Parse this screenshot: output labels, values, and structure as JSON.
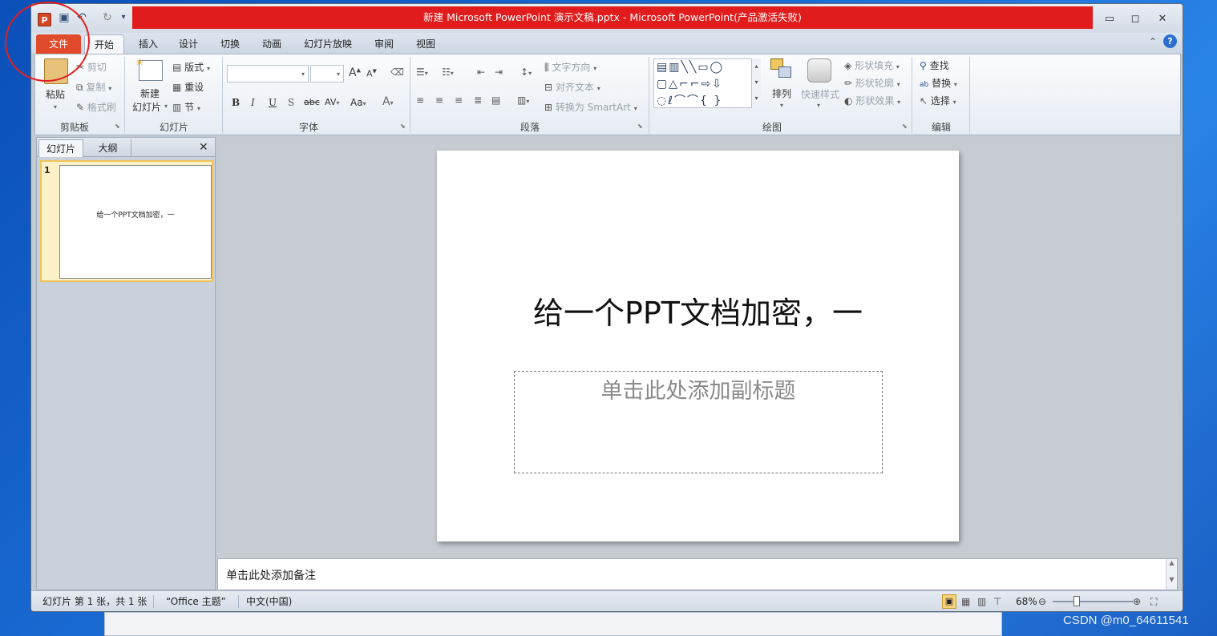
{
  "window": {
    "title": "新建 Microsoft PowerPoint 演示文稿.pptx - Microsoft PowerPoint(产品激活失败)"
  },
  "tabs": [
    {
      "label": "文件"
    },
    {
      "label": "开始"
    },
    {
      "label": "插入"
    },
    {
      "label": "设计"
    },
    {
      "label": "切换"
    },
    {
      "label": "动画"
    },
    {
      "label": "幻灯片放映"
    },
    {
      "label": "审阅"
    },
    {
      "label": "视图"
    }
  ],
  "ribbon": {
    "clipboard": {
      "paste": "粘贴",
      "cut": "剪切",
      "copy": "复制",
      "format_painter": "格式刷",
      "group": "剪贴板"
    },
    "slides": {
      "new_slide_1": "新建",
      "new_slide_2": "幻灯片",
      "layout": "版式",
      "reset": "重设",
      "section": "节",
      "group": "幻灯片"
    },
    "font": {
      "group": "字体",
      "bold": "B",
      "italic": "I",
      "underline": "U",
      "shadow": "S",
      "strike": "abc",
      "spacing": "AV",
      "case": "Aa",
      "color": "A",
      "grow": "A",
      "shrink": "A"
    },
    "paragraph": {
      "text_direction": "文字方向",
      "align_text": "对齐文本",
      "smartart": "转换为 SmartArt",
      "group": "段落"
    },
    "drawing": {
      "arrange": "排列",
      "quick_styles": "快速样式",
      "shape_fill": "形状填充",
      "shape_outline": "形状轮廓",
      "shape_effects": "形状效果",
      "group": "绘图"
    },
    "editing": {
      "find": "查找",
      "replace": "替换",
      "select": "选择",
      "group": "编辑"
    }
  },
  "left_panel": {
    "tab_slides": "幻灯片",
    "tab_outline": "大纲",
    "slide_number": "1",
    "thumb_text": "给一个PPT文档加密，一"
  },
  "slide": {
    "title": "给一个PPT文档加密，一",
    "subtitle_placeholder": "单击此处添加副标题"
  },
  "notes": {
    "placeholder": "单击此处添加备注"
  },
  "status": {
    "slide_info": "幻灯片 第 1 张，共 1 张",
    "theme": "“Office 主题”",
    "language": "中文(中国)",
    "zoom": "68%"
  },
  "watermark": "CSDN @m0_64611541",
  "colors": {
    "title_bar": "#e01c1c",
    "file_tab": "#e04a2b",
    "annotation": "#e02020"
  }
}
